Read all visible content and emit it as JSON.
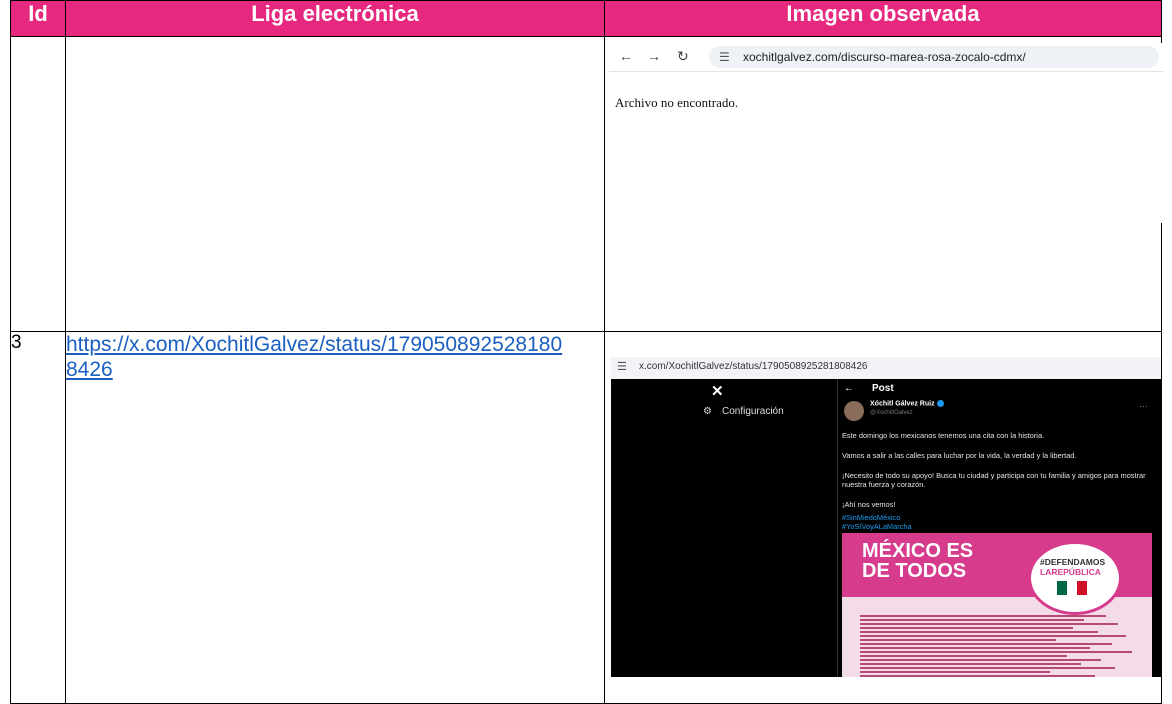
{
  "table": {
    "headers": [
      "Id",
      "Liga electrónica",
      "Imagen observada"
    ],
    "rows": [
      {
        "id": "",
        "link": ""
      },
      {
        "id": "3",
        "link": "https://x.com/XochitlGalvez/status/1790508925281808426"
      }
    ]
  },
  "shot1": {
    "url": "xochitlgalvez.com/discurso-marea-rosa-zocalo-cdmx/",
    "message": "Archivo no encontrado."
  },
  "shot2": {
    "url": "x.com/XochitlGalvez/status/1790508925281808426",
    "sidebar_item": "Configuración",
    "post_header": "Post",
    "author": "Xóchitl Gálvez Ruiz",
    "handle": "@XochitlGalvez",
    "paragraphs": [
      "Este domingo los mexicanos tenemos una cita con la historia.",
      "Vamos a salir a las calles para luchar por la vida, la verdad y la libertad.",
      "¡Necesito de todo su apoyo! Busca tu ciudad y participa con tu familia y amigos para mostrar nuestra fuerza y corazón.",
      "¡Ahí nos vemos!"
    ],
    "hashtags": [
      "#SinMiedoMéxico",
      "#YoSíVoyALaMarcha"
    ],
    "poster_title_1": "MÉXICO ES",
    "poster_title_2": "DE TODOS",
    "badge_1": "#DEFENDAMOS",
    "badge_2": "LAREPÚBLICA"
  },
  "colors": {
    "header_bg": "#e6287f",
    "link": "#1a5fc1",
    "poster_pink": "#d63b8c"
  }
}
